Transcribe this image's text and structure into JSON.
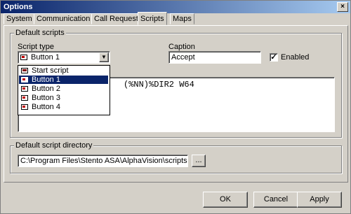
{
  "window": {
    "title": "Options",
    "close_glyph": "×"
  },
  "tabs": [
    {
      "label": "System"
    },
    {
      "label": "Communication"
    },
    {
      "label": "Call Request"
    },
    {
      "label": "Scripts",
      "active": true
    },
    {
      "label": "Maps"
    }
  ],
  "default_scripts": {
    "group_title": "Default scripts",
    "script_type_label": "Script type",
    "script_type_value": "Button 1",
    "dropdown_items": [
      "Start script",
      "Button 1",
      "Button 2",
      "Button 3",
      "Button 4"
    ],
    "selected_index": 1,
    "caption_label": "Caption",
    "caption_value": "Accept",
    "enabled_label": "Enabled",
    "enabled_checked": true,
    "script_text": "(%NN)%DIR2 W64"
  },
  "default_script_directory": {
    "group_title": "Default script directory",
    "path_value": "C:\\Program Files\\Stento ASA\\AlphaVision\\scripts",
    "browse_label": "..."
  },
  "footer": {
    "ok_label": "OK",
    "cancel_label": "Cancel",
    "apply_label": "Apply"
  }
}
